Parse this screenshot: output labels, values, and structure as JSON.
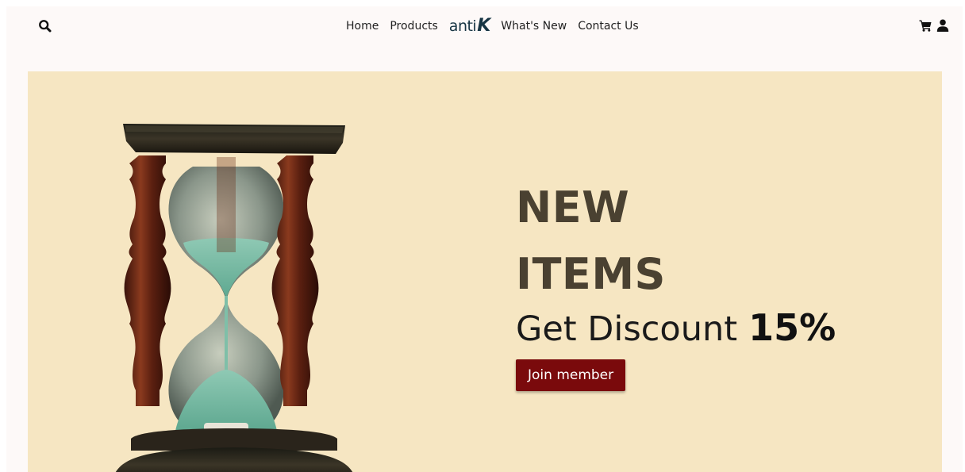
{
  "nav": {
    "search_icon": "search-icon",
    "links": {
      "home": "Home",
      "products": "Products",
      "whats_new": "What's New",
      "contact": "Contact Us"
    },
    "logo": {
      "prefix": "anti",
      "suffix": "K"
    },
    "cart_icon": "cart-icon",
    "user_icon": "user-icon"
  },
  "hero": {
    "title_line1": "NEW",
    "title_line2": "ITEMS",
    "discount_text": "Get Discount",
    "discount_value": "15%",
    "cta_label": "Join member",
    "colors": {
      "background": "#f6e6c2",
      "title": "#4a4131",
      "button": "#7a0a0c"
    }
  }
}
